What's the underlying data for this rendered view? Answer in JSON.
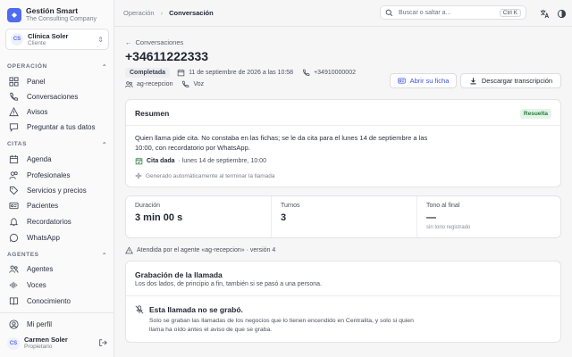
{
  "brand": {
    "name": "Gestión Smart",
    "subtitle": "The Consulting Company"
  },
  "org": {
    "initials": "CS",
    "name": "Clínica Soler",
    "role": "Cliente"
  },
  "sidebar": {
    "sections": [
      {
        "title": "OPERACIÓN",
        "items": [
          {
            "label": "Panel",
            "icon": "grid-icon"
          },
          {
            "label": "Conversaciones",
            "icon": "phone-icon"
          },
          {
            "label": "Avisos",
            "icon": "alert-icon"
          },
          {
            "label": "Preguntar a tus datos",
            "icon": "chat-icon"
          }
        ]
      },
      {
        "title": "CITAS",
        "items": [
          {
            "label": "Agenda",
            "icon": "calendar-icon"
          },
          {
            "label": "Profesionales",
            "icon": "users-icon"
          },
          {
            "label": "Servicios y precios",
            "icon": "tag-icon"
          },
          {
            "label": "Pacientes",
            "icon": "id-card-icon"
          },
          {
            "label": "Recordatorios",
            "icon": "bell-icon"
          },
          {
            "label": "WhatsApp",
            "icon": "whatsapp-icon"
          }
        ]
      },
      {
        "title": "AGENTES",
        "items": [
          {
            "label": "Agentes",
            "icon": "agents-icon"
          },
          {
            "label": "Voces",
            "icon": "voice-icon"
          },
          {
            "label": "Conocimiento",
            "icon": "book-icon"
          }
        ]
      }
    ],
    "profile_link": "Mi perfil",
    "user": {
      "initials": "CS",
      "name": "Carmen Soler",
      "role": "Propietario"
    }
  },
  "topbar": {
    "breadcrumb": [
      "Operación",
      "Conversación"
    ],
    "search_placeholder": "Buscar o saltar a...",
    "search_shortcut": "Ctrl K"
  },
  "conversation": {
    "back_label": "Conversaciones",
    "phone": "+34611222333",
    "status": "Completada",
    "datetime": "11 de septiembre de 2026 a las 10:58",
    "to_number": "+34910000002",
    "agent": "ag-recepcion",
    "channel": "Voz",
    "open_record_label": "Abrir su ficha",
    "download_label": "Descargar transcripción"
  },
  "summary": {
    "title": "Resumen",
    "badge": "Resuelta",
    "text": "Quien llama pide cita. No constaba en las fichas; se le da cita para el lunes 14 de septiembre a las 10:00, con recordatorio por WhatsApp.",
    "appointment_label": "Cita dada",
    "appointment_value": "· lunes 14 de septiembre, 10:00",
    "auto_note": "Generado automáticamente al terminar la llamada"
  },
  "stats": [
    {
      "label": "Duración",
      "value": "3 min 00 s",
      "sub": ""
    },
    {
      "label": "Turnos",
      "value": "3",
      "sub": ""
    },
    {
      "label": "Tono al final",
      "value": "—",
      "sub": "sin tono registrado"
    }
  ],
  "agent_line": "Atendida por el agente «ag-recepcion» · versión 4",
  "recording": {
    "title": "Grabación de la llamada",
    "description": "Los dos lados, de principio a fin, también si se pasó a una persona.",
    "warning_title": "Esta llamada no se grabó.",
    "warning_body": "Solo se graban las llamadas de los negocios que lo tienen encendido en Centralita, y solo si quien llama ha oído antes el aviso de que se graba."
  },
  "colors": {
    "accent": "#4f6cf0",
    "success": "#267a3c",
    "success_bg": "#e4f5e8"
  }
}
